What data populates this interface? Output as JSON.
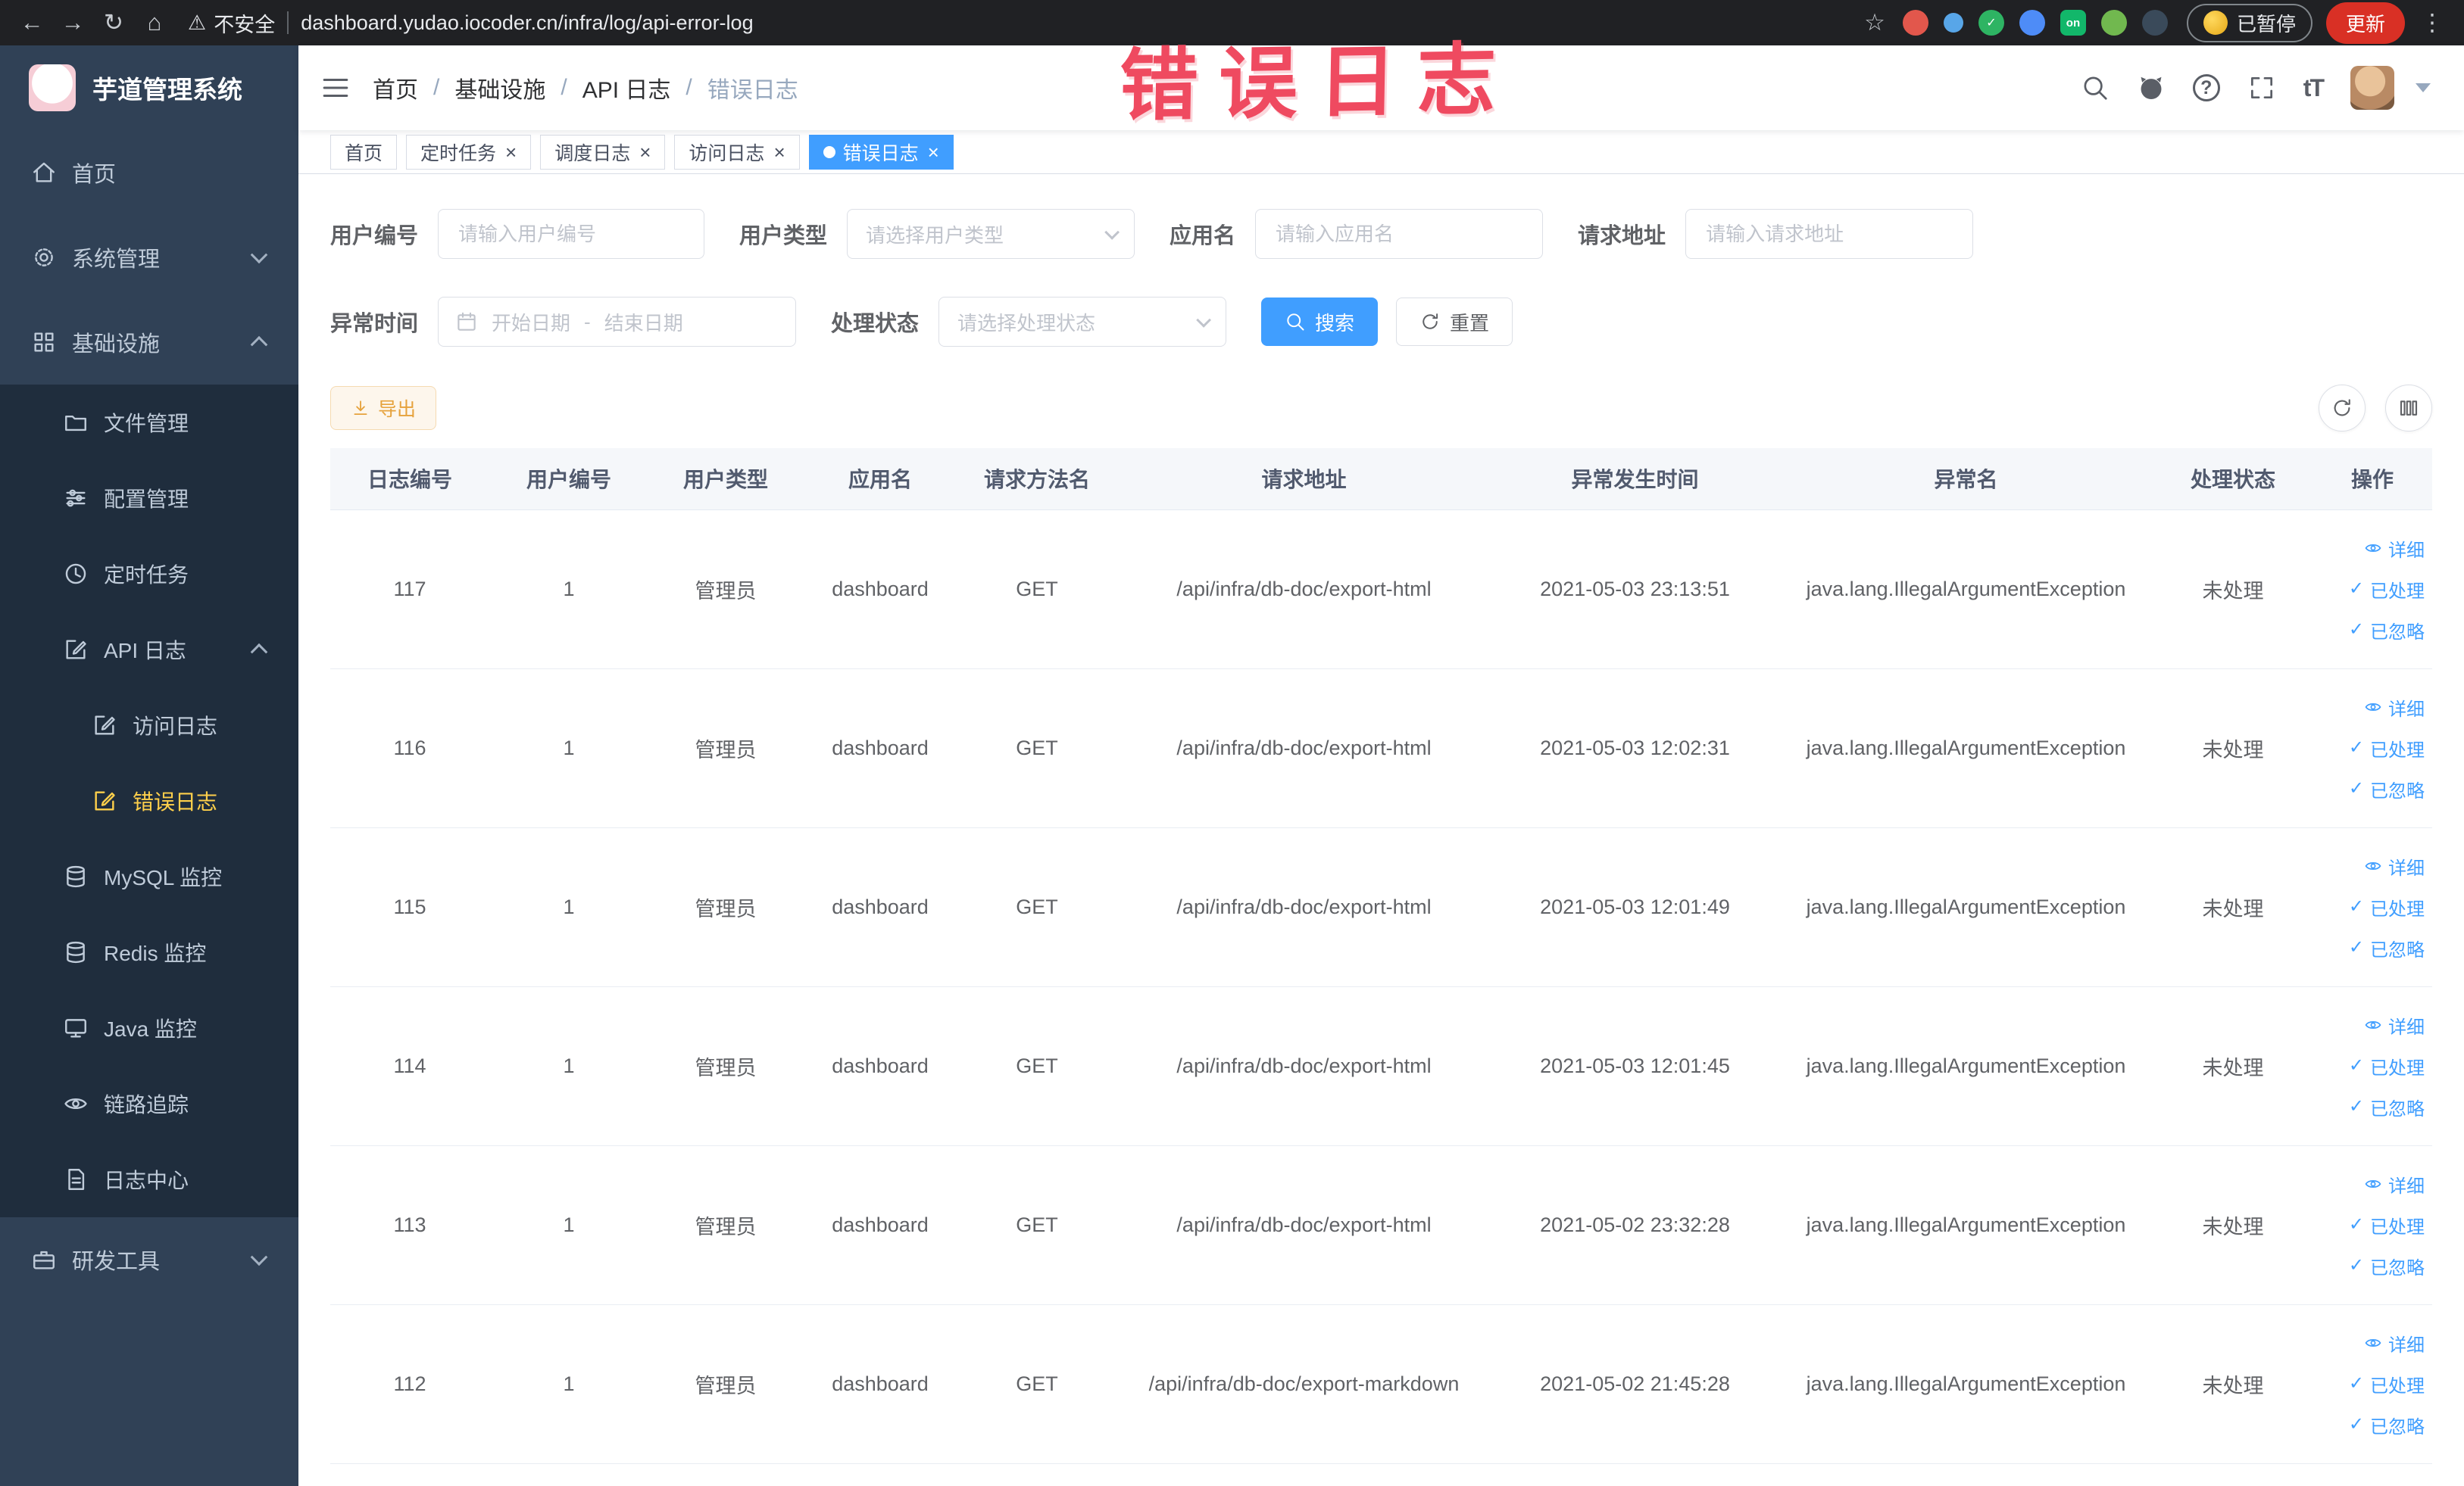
{
  "browser": {
    "security_label": "不安全",
    "url": "dashboard.yudao.iocoder.cn/infra/log/api-error-log",
    "paused_label": "已暂停",
    "update_label": "更新",
    "ext_on_badge": "on"
  },
  "annotation": "错误日志",
  "theme": {
    "accent": "#409eff",
    "sidebar_bg": "#304156",
    "submenu_bg": "#1f2d3d",
    "active_menu_text": "#ffd04b",
    "warning": "#e6a23c",
    "annotation_red": "#ef4a60",
    "update_red": "#d93025"
  },
  "sidebar": {
    "logo_title": "芋道管理系统",
    "items": [
      {
        "label": "首页"
      },
      {
        "label": "系统管理"
      },
      {
        "label": "基础设施"
      },
      {
        "label": "文件管理"
      },
      {
        "label": "配置管理"
      },
      {
        "label": "定时任务"
      },
      {
        "label": "API 日志"
      },
      {
        "label": "访问日志"
      },
      {
        "label": "错误日志"
      },
      {
        "label": "MySQL 监控"
      },
      {
        "label": "Redis 监控"
      },
      {
        "label": "Java 监控"
      },
      {
        "label": "链路追踪"
      },
      {
        "label": "日志中心"
      },
      {
        "label": "研发工具"
      }
    ]
  },
  "header": {
    "breadcrumb": [
      "首页",
      "基础设施",
      "API 日志",
      "错误日志"
    ],
    "breadcrumb_separator": "/"
  },
  "tabs": [
    {
      "label": "首页"
    },
    {
      "label": "定时任务"
    },
    {
      "label": "调度日志"
    },
    {
      "label": "访问日志"
    },
    {
      "label": "错误日志"
    }
  ],
  "filters": {
    "user_id_label": "用户编号",
    "user_id_placeholder": "请输入用户编号",
    "user_type_label": "用户类型",
    "user_type_placeholder": "请选择用户类型",
    "app_name_label": "应用名",
    "app_name_placeholder": "请输入应用名",
    "request_url_label": "请求地址",
    "request_url_placeholder": "请输入请求地址",
    "exception_time_label": "异常时间",
    "date_start_placeholder": "开始日期",
    "date_separator": "-",
    "date_end_placeholder": "结束日期",
    "process_status_label": "处理状态",
    "process_status_placeholder": "请选择处理状态",
    "search_label": "搜索",
    "reset_label": "重置"
  },
  "toolbar": {
    "export_label": "导出"
  },
  "table": {
    "columns": [
      "日志编号",
      "用户编号",
      "用户类型",
      "应用名",
      "请求方法名",
      "请求地址",
      "异常发生时间",
      "异常名",
      "处理状态",
      "操作"
    ],
    "row_actions": [
      "详细",
      "已处理",
      "已忽略"
    ],
    "rows": [
      {
        "id": "117",
        "user_id": "1",
        "user_type": "管理员",
        "app_name": "dashboard",
        "method": "GET",
        "url": "/api/infra/db-doc/export-html",
        "time": "2021-05-03 23:13:51",
        "exception": "java.lang.IllegalArgumentException",
        "status": "未处理"
      },
      {
        "id": "116",
        "user_id": "1",
        "user_type": "管理员",
        "app_name": "dashboard",
        "method": "GET",
        "url": "/api/infra/db-doc/export-html",
        "time": "2021-05-03 12:02:31",
        "exception": "java.lang.IllegalArgumentException",
        "status": "未处理"
      },
      {
        "id": "115",
        "user_id": "1",
        "user_type": "管理员",
        "app_name": "dashboard",
        "method": "GET",
        "url": "/api/infra/db-doc/export-html",
        "time": "2021-05-03 12:01:49",
        "exception": "java.lang.IllegalArgumentException",
        "status": "未处理"
      },
      {
        "id": "114",
        "user_id": "1",
        "user_type": "管理员",
        "app_name": "dashboard",
        "method": "GET",
        "url": "/api/infra/db-doc/export-html",
        "time": "2021-05-03 12:01:45",
        "exception": "java.lang.IllegalArgumentException",
        "status": "未处理"
      },
      {
        "id": "113",
        "user_id": "1",
        "user_type": "管理员",
        "app_name": "dashboard",
        "method": "GET",
        "url": "/api/infra/db-doc/export-html",
        "time": "2021-05-02 23:32:28",
        "exception": "java.lang.IllegalArgumentException",
        "status": "未处理"
      },
      {
        "id": "112",
        "user_id": "1",
        "user_type": "管理员",
        "app_name": "dashboard",
        "method": "GET",
        "url": "/api/infra/db-doc/export-markdown",
        "time": "2021-05-02 21:45:28",
        "exception": "java.lang.IllegalArgumentException",
        "status": "未处理"
      }
    ]
  }
}
